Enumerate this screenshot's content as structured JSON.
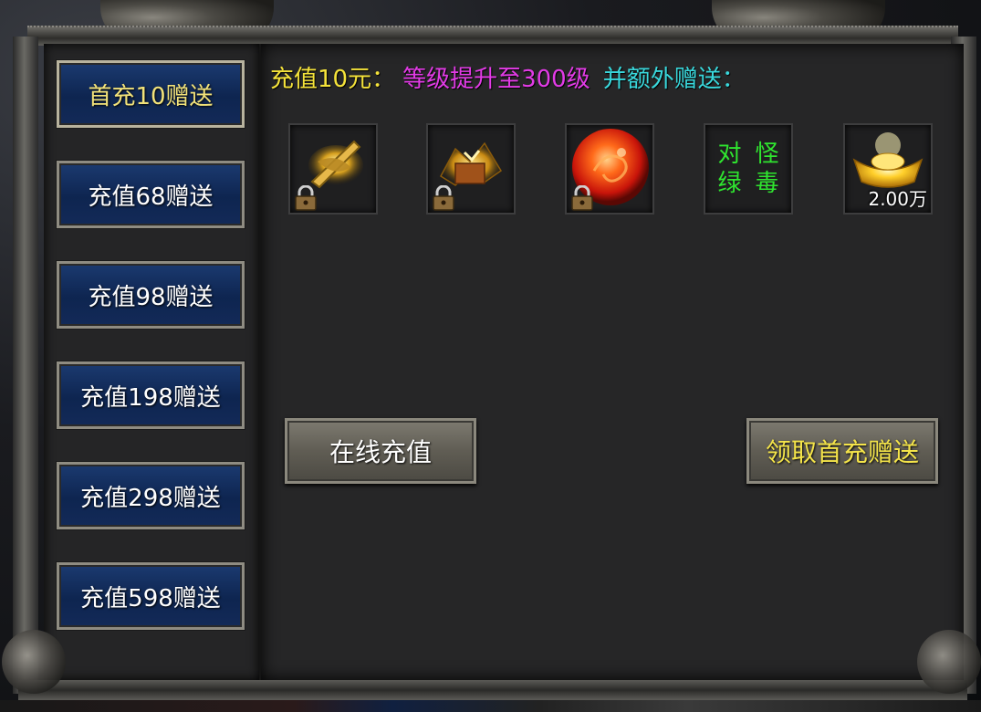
{
  "sidebar": {
    "tabs": [
      {
        "label": "首充10赠送",
        "active": true
      },
      {
        "label": "充值68赠送",
        "active": false
      },
      {
        "label": "充值98赠送",
        "active": false
      },
      {
        "label": "充值198赠送",
        "active": false
      },
      {
        "label": "充值298赠送",
        "active": false
      },
      {
        "label": "充值598赠送",
        "active": false
      }
    ]
  },
  "headline": {
    "part1": "充值10元：",
    "part2": "等级提升至300级",
    "part3": "并额外赠送："
  },
  "rewards": [
    {
      "icon": "golden-blade-icon",
      "locked": true
    },
    {
      "icon": "golden-wing-book-icon",
      "locked": true
    },
    {
      "icon": "red-dragon-orb-icon",
      "locked": true
    },
    {
      "icon": "text-item",
      "chars": [
        "对",
        "怪",
        "绿",
        "毒"
      ],
      "locked": false
    },
    {
      "icon": "gold-ingot-icon",
      "amount": "2.00万",
      "locked": false
    }
  ],
  "buttons": {
    "recharge_online": "在线充值",
    "claim_first_recharge": "领取首充赠送"
  },
  "colors": {
    "accent_yellow": "#f5e33a",
    "accent_magenta": "#e23be6",
    "accent_cyan": "#39d8dc",
    "poison_green": "#2fe52f",
    "tab_blue": "#0e2550"
  }
}
